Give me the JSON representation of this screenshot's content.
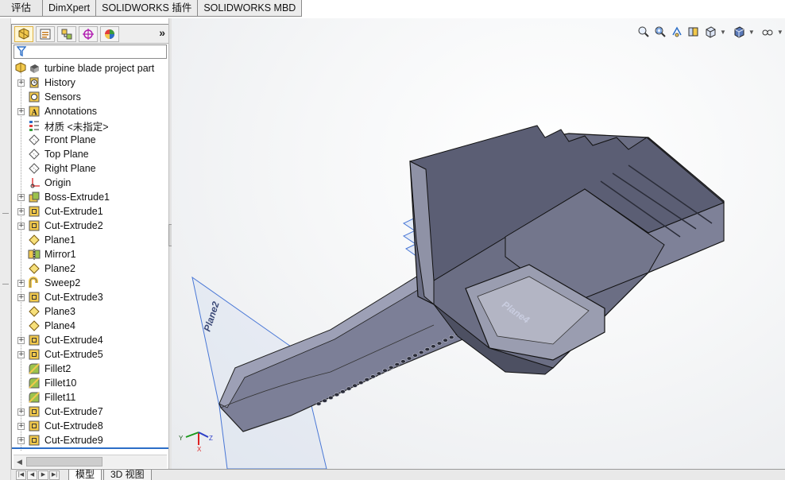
{
  "command_tabs": [
    "评估",
    "DimXpert",
    "SOLIDWORKS 插件",
    "SOLIDWORKS MBD"
  ],
  "panel_toolbar": {
    "buttons": [
      "feature-manager-icon",
      "property-manager-icon",
      "configuration-manager-icon",
      "dimxpert-manager-icon",
      "display-manager-icon"
    ],
    "expand_label": "»"
  },
  "filter": {
    "icon": "filter-icon",
    "value": ""
  },
  "tree": {
    "root": {
      "label": "turbine blade project part",
      "icon": "part-icon"
    },
    "items": [
      {
        "label": "History",
        "icon": "history-icon",
        "expandable": true
      },
      {
        "label": "Sensors",
        "icon": "sensor-icon",
        "expandable": false
      },
      {
        "label": "Annotations",
        "icon": "annotations-icon",
        "expandable": true
      },
      {
        "label": "材质 <未指定>",
        "icon": "material-icon",
        "expandable": false
      },
      {
        "label": "Front Plane",
        "icon": "plane-icon",
        "expandable": false
      },
      {
        "label": "Top Plane",
        "icon": "plane-icon",
        "expandable": false
      },
      {
        "label": "Right Plane",
        "icon": "plane-icon",
        "expandable": false
      },
      {
        "label": "Origin",
        "icon": "origin-icon",
        "expandable": false
      },
      {
        "label": "Boss-Extrude1",
        "icon": "boss-extrude-icon",
        "expandable": true
      },
      {
        "label": "Cut-Extrude1",
        "icon": "cut-extrude-icon",
        "expandable": true
      },
      {
        "label": "Cut-Extrude2",
        "icon": "cut-extrude-icon",
        "expandable": true
      },
      {
        "label": "Plane1",
        "icon": "plane-feature-icon",
        "expandable": false
      },
      {
        "label": "Mirror1",
        "icon": "mirror-icon",
        "expandable": false
      },
      {
        "label": "Plane2",
        "icon": "plane-feature-icon",
        "expandable": false
      },
      {
        "label": "Sweep2",
        "icon": "sweep-icon",
        "expandable": true
      },
      {
        "label": "Cut-Extrude3",
        "icon": "cut-extrude-icon",
        "expandable": true
      },
      {
        "label": "Plane3",
        "icon": "plane-feature-icon",
        "expandable": false
      },
      {
        "label": "Plane4",
        "icon": "plane-feature-icon",
        "expandable": false
      },
      {
        "label": "Cut-Extrude4",
        "icon": "cut-extrude-icon",
        "expandable": true
      },
      {
        "label": "Cut-Extrude5",
        "icon": "cut-extrude-icon",
        "expandable": true
      },
      {
        "label": "Fillet2",
        "icon": "fillet-icon",
        "expandable": false
      },
      {
        "label": "Fillet10",
        "icon": "fillet-icon",
        "expandable": false
      },
      {
        "label": "Fillet11",
        "icon": "fillet-icon",
        "expandable": false
      },
      {
        "label": "Cut-Extrude7",
        "icon": "cut-extrude-icon",
        "expandable": true
      },
      {
        "label": "Cut-Extrude8",
        "icon": "cut-extrude-icon",
        "expandable": true
      },
      {
        "label": "Cut-Extrude9",
        "icon": "cut-extrude-icon",
        "expandable": true
      }
    ]
  },
  "bottom_tabs": [
    "模型",
    "3D 视图"
  ],
  "view_toolbar": [
    "zoom-to-fit-icon",
    "zoom-to-area-icon",
    "previous-view-icon",
    "section-view-icon",
    "view-orientation-icon",
    "display-style-icon",
    "hide-show-items-icon",
    "edit-appearance-icon",
    "apply-scene-icon",
    "view-settings-icon"
  ],
  "viewport": {
    "plane_labels": [
      "Plane2",
      "Plane4"
    ],
    "triad": {
      "x": "X",
      "y": "Y",
      "z": "Z"
    }
  },
  "colors": {
    "accent": "#2c6ec7",
    "model_face": "#6b6e84",
    "model_dark": "#3c3e4f",
    "plane": "#4a78d6"
  }
}
